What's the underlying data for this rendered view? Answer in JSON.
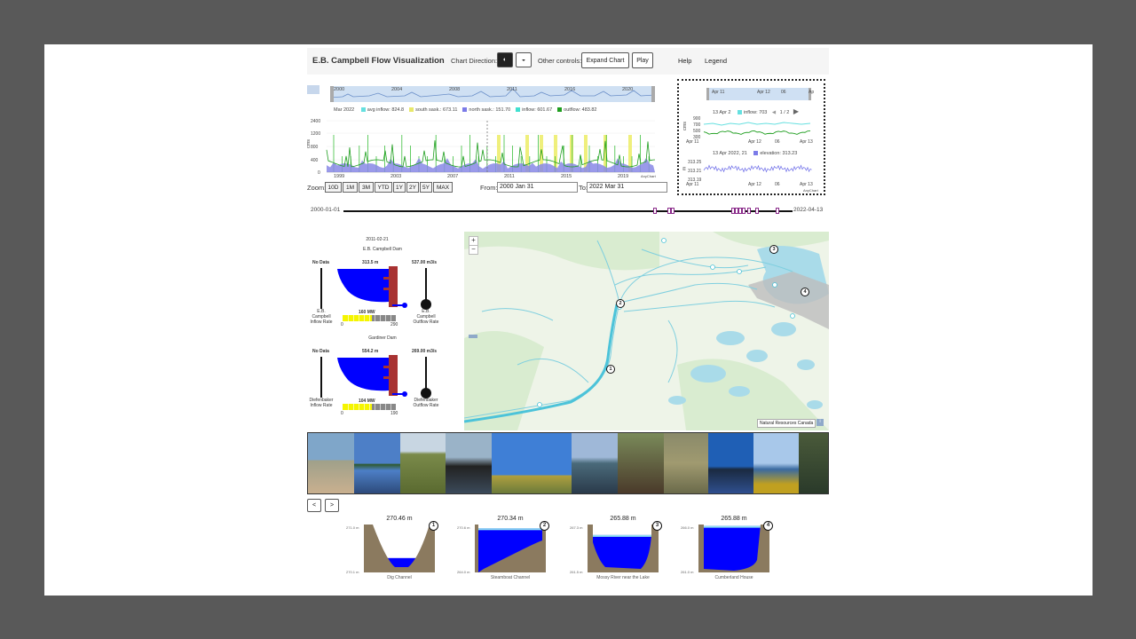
{
  "header": {
    "title": "E.B. Campbell Flow Visualization",
    "chart_direction_label": "Chart Direction:",
    "other_controls_label": "Other controls:",
    "expand_chart": "Expand Chart",
    "play": "Play",
    "help": "Help",
    "legend": "Legend"
  },
  "main_chart": {
    "navigator_years": [
      "2000",
      "2004",
      "2008",
      "2011",
      "2016",
      "2020"
    ],
    "axis_years": [
      "1999",
      "2003",
      "2007",
      "2011",
      "2015",
      "2019"
    ],
    "y_ticks": [
      "2400",
      "1600",
      "1200",
      "800",
      "400",
      "0"
    ],
    "y_label": "cms",
    "legend_date": "Mar 2022",
    "legend": [
      {
        "name": "avg inflow",
        "value": "824.8",
        "color": "#66e0e0"
      },
      {
        "name": "south sask.",
        "value": "673.11",
        "color": "#e8e86a"
      },
      {
        "name": "north sask.",
        "value": "151.70",
        "color": "#7b7be8"
      },
      {
        "name": "inflow",
        "value": "601.67",
        "color": "#40e0d0"
      },
      {
        "name": "outflow",
        "value": "483.82",
        "color": "#1f9e1f"
      }
    ],
    "credit": "AnyChart"
  },
  "side_chart": {
    "nav_labels": [
      "Apr 11",
      "Apr 12",
      "06",
      "Ap"
    ],
    "top_legend_date": "13 Apr 2",
    "top_legend": {
      "name": "inflow",
      "value": "703",
      "color": "#66e0e0"
    },
    "pager": "1 / 2",
    "top_y": [
      "900",
      "700",
      "500",
      "300"
    ],
    "axis_labels": [
      "Apr 11",
      "Apr 12",
      "06",
      "Apr 13"
    ],
    "bottom_legend_date": "13 Apr 2022, 21",
    "bottom_legend": {
      "name": "elevation",
      "value": "313.23",
      "color": "#7b7be8"
    },
    "bottom_y": [
      "313.25",
      "313.21",
      "313.19"
    ],
    "y_label_top": "cms",
    "y_label_bottom": "m",
    "credit": "AnyChart"
  },
  "zoom": {
    "label": "Zoom:",
    "buttons": [
      "10D",
      "1M",
      "3M",
      "YTD",
      "1Y",
      "2Y",
      "5Y",
      "MAX"
    ],
    "from_label": "From:",
    "from_value": "2000 Jan 31",
    "to_label": "To:",
    "to_value": "2022 Mar 31"
  },
  "timeline": {
    "start": "2000-01-01",
    "end": "2022-04-13"
  },
  "dams": {
    "date": "2011-02-21",
    "campbell": {
      "name": "E.B. Campbell Dam",
      "inflow_value": "No Data",
      "elevation": "313.5 m",
      "outflow_value": "537.00 m3/s",
      "inflow_label": [
        "E.B.",
        "Campbell",
        "Inflow Rate"
      ],
      "outflow_label": [
        "E.B.",
        "Campbell",
        "Outflow Rate"
      ],
      "power": "160 MW",
      "power_min": "0",
      "power_max": "290",
      "power_fraction": 0.55
    },
    "gardiner": {
      "name": "Gardiner Dam",
      "inflow_value": "No Data",
      "elevation": "554.2 m",
      "outflow_value": "269.00 m3/s",
      "inflow_label": [
        "Diefenbaker",
        "Inflow Rate"
      ],
      "outflow_label": [
        "Diefenbaker",
        "Outflow Rate"
      ],
      "power": "104 MW",
      "power_min": "0",
      "power_max": "190",
      "power_fraction": 0.55
    }
  },
  "map": {
    "zoom_in": "+",
    "zoom_out": "−",
    "attribution": "Natural Resources Canada",
    "markers": [
      "1",
      "2",
      "3",
      "4"
    ]
  },
  "gallery": {
    "prev": "<",
    "next": ">"
  },
  "cross_sections": [
    {
      "num": "1",
      "elevation": "270.46 m",
      "caption": "Dig Channel",
      "y_top": "271.0 m",
      "y_bottom": "270.1 m",
      "fill": 0.3
    },
    {
      "num": "2",
      "elevation": "270.34 m",
      "caption": "Steamboat Channel",
      "y_top": "270.6 m",
      "y_bottom": "264.0 m",
      "fill": 0.92
    },
    {
      "num": "3",
      "elevation": "265.88 m",
      "caption": "Mossy River near the Lake",
      "y_top": "267.3 m",
      "y_bottom": "261.5 m",
      "fill": 0.78
    },
    {
      "num": "4",
      "elevation": "265.88 m",
      "caption": "Cumberland House",
      "y_top": "266.0 m",
      "y_bottom": "261.0 m",
      "fill": 0.97
    }
  ]
}
